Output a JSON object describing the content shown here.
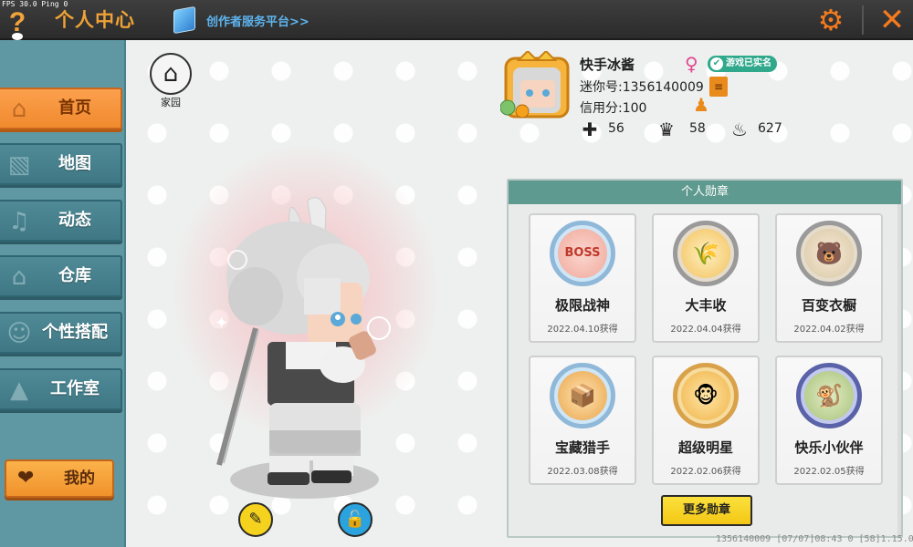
{
  "topbar": {
    "fps": "FPS 30.0",
    "ping": "Ping 0",
    "title": "个人中心",
    "creator_link": "创作者服务平台>>"
  },
  "sidebar": {
    "items": [
      {
        "label": "首页",
        "icon": "house-icon",
        "active": true
      },
      {
        "label": "地图",
        "icon": "map-icon",
        "active": false
      },
      {
        "label": "动态",
        "icon": "bell-icon",
        "active": false
      },
      {
        "label": "仓库",
        "icon": "warehouse-icon",
        "active": false
      },
      {
        "label": "个性搭配",
        "icon": "outfit-icon",
        "active": false
      },
      {
        "label": "工作室",
        "icon": "studio-icon",
        "active": false
      }
    ],
    "mine_label": "我的"
  },
  "home": {
    "label": "家园"
  },
  "profile": {
    "name": "快手冰酱",
    "verified_label": "游戏已实名",
    "mini_id": "迷你号:1356140009",
    "credit": "信用分:100",
    "stats": [
      {
        "icon": "plus-icon",
        "value": "56"
      },
      {
        "icon": "cheer-icon",
        "value": "58"
      },
      {
        "icon": "flame-icon",
        "value": "627"
      }
    ]
  },
  "badges": {
    "header": "个人勋章",
    "items": [
      {
        "name": "极限战神",
        "date": "2022.04.10获得",
        "icon": "boss-medal-icon",
        "glyph": "BOSS"
      },
      {
        "name": "大丰收",
        "date": "2022.04.04获得",
        "icon": "harvest-medal-icon",
        "glyph": "🌾"
      },
      {
        "name": "百变衣橱",
        "date": "2022.04.02获得",
        "icon": "wardrobe-medal-icon",
        "glyph": "🐻"
      },
      {
        "name": "宝藏猎手",
        "date": "2022.03.08获得",
        "icon": "treasure-medal-icon",
        "glyph": "📦"
      },
      {
        "name": "超级明星",
        "date": "2022.02.06获得",
        "icon": "star-medal-icon",
        "glyph": "🐵"
      },
      {
        "name": "快乐小伙伴",
        "date": "2022.02.05获得",
        "icon": "friends-medal-icon",
        "glyph": "🐒"
      }
    ],
    "more_label": "更多勋章"
  },
  "footer": "1356140009    [07/07]08:43 0   [58]1.15.0",
  "colors": {
    "accent_orange": "#f08a2e",
    "sidebar_teal": "#4f8a96",
    "badge_header": "#5e9a8f",
    "more_button": "#f3c715"
  }
}
